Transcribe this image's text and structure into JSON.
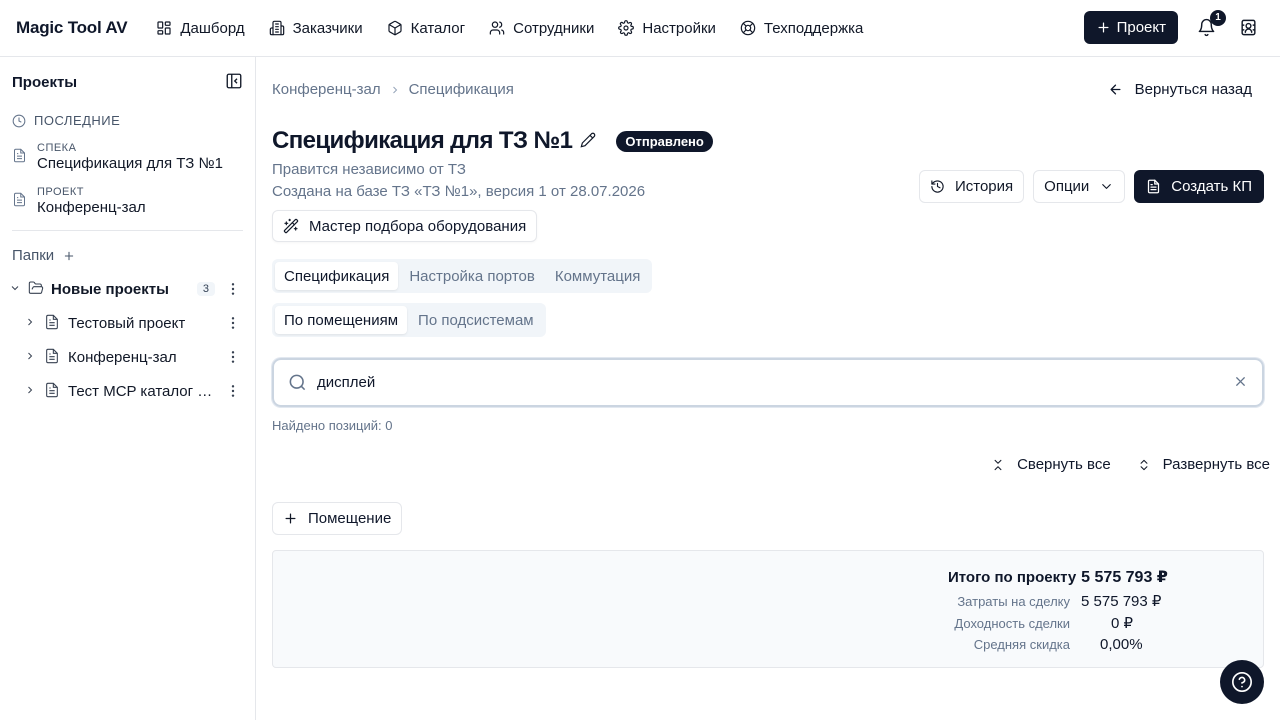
{
  "app": {
    "brand": "Magic Tool AV"
  },
  "nav": {
    "items": [
      {
        "label": "Дашборд",
        "icon": "grid-icon"
      },
      {
        "label": "Заказчики",
        "icon": "building-icon"
      },
      {
        "label": "Каталог",
        "icon": "box-icon"
      },
      {
        "label": "Сотрудники",
        "icon": "users-icon"
      },
      {
        "label": "Настройки",
        "icon": "gear-icon"
      },
      {
        "label": "Техподдержка",
        "icon": "lifebuoy-icon"
      }
    ],
    "new_project_label": "Проект",
    "notifications_count": "1"
  },
  "sidebar": {
    "title": "Проекты",
    "recent_heading": "ПОСЛЕДНИЕ",
    "recent": [
      {
        "kind": "СПЕКА",
        "name": "Спецификация для ТЗ №1"
      },
      {
        "kind": "ПРОЕКТ",
        "name": "Конференц-зал"
      }
    ],
    "folders_heading": "Папки",
    "folder": {
      "name": "Новые проекты",
      "count": "3"
    },
    "projects": [
      {
        "name": "Тестовый проект"
      },
      {
        "name": "Конференц-зал"
      },
      {
        "name": "Тест MCP каталог оборудования"
      }
    ]
  },
  "main": {
    "breadcrumb": [
      "Конференц-зал",
      "Спецификация"
    ],
    "back_label": "Вернуться назад",
    "title": "Спецификация для ТЗ №1",
    "status": "Отправлено",
    "subtitle1": "Правится независимо от ТЗ",
    "subtitle2": "Создана на базе ТЗ «ТЗ №1», версия 1 от 28.07.2026",
    "wizard_label": "Мастер подбора оборудования",
    "history_label": "История",
    "options_label": "Опции",
    "create_kp_label": "Создать КП",
    "tabs": [
      "Спецификация",
      "Настройка портов",
      "Коммутация"
    ],
    "subtabs": [
      "По помещениям",
      "По подсистемам"
    ],
    "search_value": "дисплей",
    "found": "Найдено позиций: 0",
    "collapse_all": "Свернуть все",
    "expand_all": "Развернуть все",
    "add_room_label": "Помещение",
    "totals": {
      "total_label": "Итого по проекту",
      "total_value": "5 575 793 ₽",
      "cost_label": "Затраты на сделку",
      "cost_value": "5 575 793 ₽",
      "profit_label": "Доходность сделки",
      "profit_value": "0 ₽",
      "discount_label": "Средняя скидка",
      "discount_value": "0,00%"
    }
  }
}
